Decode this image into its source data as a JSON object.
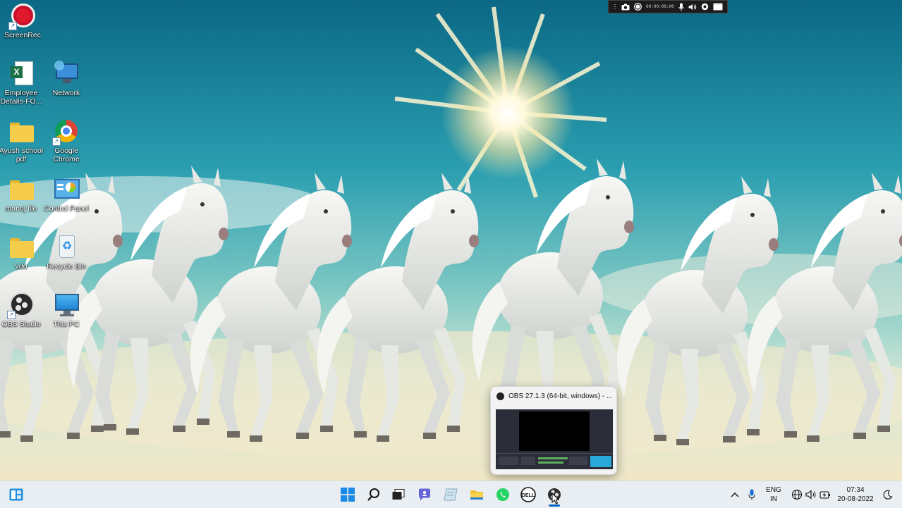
{
  "desktop": {
    "icons": [
      {
        "label": "ScreenRec",
        "icon": "screenrec-icon"
      },
      {
        "label": "Employee Details-FO...",
        "icon": "excel-file-icon"
      },
      {
        "label": "Network",
        "icon": "network-icon"
      },
      {
        "label": "Ayush school pdf",
        "icon": "folder-icon"
      },
      {
        "label": "Google Chrome",
        "icon": "chrome-icon"
      },
      {
        "label": "manoj file",
        "icon": "folder-icon"
      },
      {
        "label": "Control Panel",
        "icon": "control-panel-icon"
      },
      {
        "label": "vdo",
        "icon": "folder-icon"
      },
      {
        "label": "Recycle Bin",
        "icon": "recycle-bin-icon"
      },
      {
        "label": "OBS Studio",
        "icon": "obs-icon"
      },
      {
        "label": "This PC",
        "icon": "this-pc-icon"
      }
    ]
  },
  "recorder_bar": {
    "timer": "00:00:00:00",
    "buttons": [
      "camera-icon",
      "record-icon",
      "microphone-icon",
      "speaker-icon",
      "webcam-icon",
      "window-icon"
    ]
  },
  "preview": {
    "title": "OBS 27.1.3 (64-bit, windows) - ..."
  },
  "taskbar": {
    "apps": [
      "widgets-icon",
      "start-icon",
      "search-icon",
      "task-view-icon",
      "teams-chat-icon",
      "notepad-icon",
      "file-explorer-icon",
      "whatsapp-icon",
      "dell-icon",
      "obs-icon"
    ],
    "tray": {
      "language": "ENG",
      "region": "IN",
      "time": "07:34",
      "date": "20-08-2022"
    }
  },
  "colors": {
    "sky_top": "#0f6f8c",
    "sky_mid": "#2aa3b5",
    "sky_low": "#bfe3de",
    "taskbar": "#e9eef2",
    "accent_blue": "#0a64c8"
  }
}
